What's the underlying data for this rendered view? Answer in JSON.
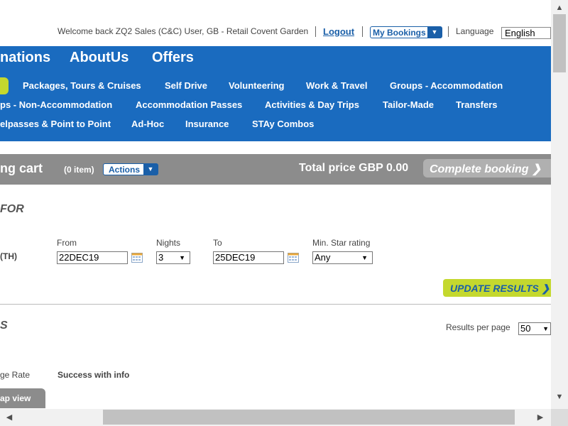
{
  "header": {
    "welcome_text": "Welcome back ZQ2 Sales (C&C) User, GB - Retail Covent Garden",
    "logout_label": "Logout",
    "my_bookings_label": "My Bookings",
    "language_label": "Language",
    "language_value": "English"
  },
  "nav": {
    "main_items": [
      "nations",
      "AboutUs",
      "Offers"
    ],
    "row1": [
      "Packages, Tours & Cruises",
      "Self Drive",
      "Volunteering",
      "Work & Travel",
      "Groups - Accommodation"
    ],
    "row2": [
      "ps - Non-Accommodation",
      "Accommodation Passes",
      "Activities & Day Trips",
      "Tailor-Made",
      "Transfers"
    ],
    "row3": [
      "elpasses & Point to Point",
      "Ad-Hoc",
      "Insurance",
      "STAy Combos"
    ]
  },
  "cart": {
    "title": "ng cart",
    "count": "(0 item)",
    "actions_label": "Actions",
    "total": "Total price GBP 0.00",
    "complete_label": "Complete booking"
  },
  "search": {
    "section_title": "FOR",
    "location_suffix": "(TH)",
    "from_label": "From",
    "from_value": "22DEC19",
    "nights_label": "Nights",
    "nights_value": "3",
    "to_label": "To",
    "to_value": "25DEC19",
    "star_label": "Min. Star rating",
    "star_value": "Any",
    "update_label": "UPDATE RESULTS"
  },
  "results": {
    "section_title": "S",
    "per_page_label": "Results per page",
    "per_page_value": "50",
    "rate_label": "ge Rate",
    "status_text": "Success with info",
    "map_view_label": "ap view"
  },
  "colors": {
    "nav_blue": "#1a6bbf",
    "accent_green": "#c4d82e",
    "cart_grey": "#8c8c8c"
  }
}
